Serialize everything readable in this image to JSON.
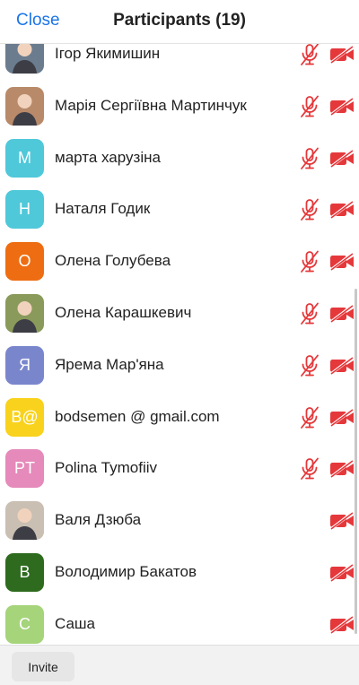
{
  "header": {
    "close_label": "Close",
    "title": "Participants (19)"
  },
  "participants": [
    {
      "name": "Ігор Якимишин",
      "avatar_type": "photo",
      "initials": "",
      "avatar_color": "#6b7c8e",
      "mic_muted": true,
      "video_off": true
    },
    {
      "name": "Марія Сергіївна Мартинчук",
      "avatar_type": "photo",
      "initials": "",
      "avatar_color": "#b88a6a",
      "mic_muted": true,
      "video_off": true
    },
    {
      "name": "марта харузіна",
      "avatar_type": "initials",
      "initials": "М",
      "avatar_color": "#4fc8d9",
      "mic_muted": true,
      "video_off": true
    },
    {
      "name": "Наталя Годик",
      "avatar_type": "initials",
      "initials": "Н",
      "avatar_color": "#4fc8d9",
      "mic_muted": true,
      "video_off": true
    },
    {
      "name": "Олена Голубева",
      "avatar_type": "initials",
      "initials": "О",
      "avatar_color": "#ee6d12",
      "mic_muted": true,
      "video_off": true
    },
    {
      "name": "Олена Карашкевич",
      "avatar_type": "photo",
      "initials": "",
      "avatar_color": "#8a9a5b",
      "mic_muted": true,
      "video_off": true
    },
    {
      "name": "Ярема Мар'яна",
      "avatar_type": "initials",
      "initials": "Я",
      "avatar_color": "#7a86cc",
      "mic_muted": true,
      "video_off": true
    },
    {
      "name": "bodsemen @ gmail.com",
      "avatar_type": "initials",
      "initials": "B@",
      "avatar_color": "#f8d21c",
      "mic_muted": true,
      "video_off": true
    },
    {
      "name": "Polina Tymofiiv",
      "avatar_type": "initials",
      "initials": "PT",
      "avatar_color": "#e58aba",
      "mic_muted": true,
      "video_off": true
    },
    {
      "name": "Валя Дзюба",
      "avatar_type": "photo",
      "initials": "",
      "avatar_color": "#c9bfb2",
      "mic_muted": false,
      "video_off": true
    },
    {
      "name": "Володимир Бакатов",
      "avatar_type": "initials",
      "initials": "В",
      "avatar_color": "#2e6b1f",
      "mic_muted": false,
      "video_off": true
    },
    {
      "name": "Саша",
      "avatar_type": "initials",
      "initials": "С",
      "avatar_color": "#a5d47a",
      "mic_muted": false,
      "video_off": true
    }
  ],
  "footer": {
    "invite_label": "Invite"
  },
  "icons": {
    "mic": "mic-muted-icon",
    "video": "video-off-icon"
  },
  "colors": {
    "accent": "#1b74e8",
    "muted_red": "#e5383b"
  }
}
